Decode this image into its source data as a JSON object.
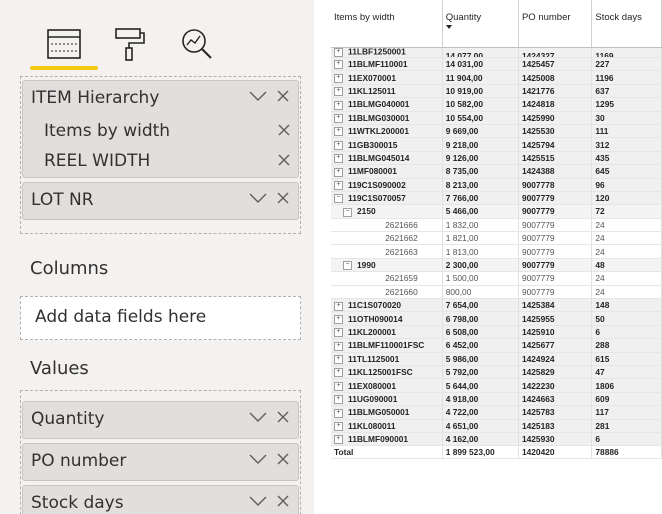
{
  "pane": {
    "icons": [
      "table-fields-icon",
      "paint-roller-format-icon",
      "analytics-magnifier-icon"
    ],
    "rows_well": {
      "hierarchy_label": "ITEM Hierarchy",
      "hierarchy_children": [
        "Items by width",
        "REEL WIDTH"
      ],
      "lot_label": "LOT NR"
    },
    "columns_label": "Columns",
    "columns_placeholder": "Add data fields here",
    "values_label": "Values",
    "values_fields": [
      "Quantity",
      "PO number",
      "Stock days"
    ]
  },
  "matrix": {
    "headers": [
      "Items by width",
      "Quantity",
      "PO number",
      "Stock days"
    ],
    "sorted_column": "Quantity",
    "cut_row": {
      "item": "11LBF1250001",
      "qty": "14 077,00",
      "po": "1424327",
      "days": "1169"
    },
    "rows": [
      {
        "level": 0,
        "item": "11BLMF110001",
        "qty": "14 031,00",
        "po": "1425457",
        "days": "227"
      },
      {
        "level": 0,
        "item": "11EX070001",
        "qty": "11 904,00",
        "po": "1425008",
        "days": "1196"
      },
      {
        "level": 0,
        "item": "11KL125011",
        "qty": "10 919,00",
        "po": "1421776",
        "days": "637"
      },
      {
        "level": 0,
        "item": "11BLMG040001",
        "qty": "10 582,00",
        "po": "1424818",
        "days": "1295"
      },
      {
        "level": 0,
        "item": "11BLMG030001",
        "qty": "10 554,00",
        "po": "1425990",
        "days": "30"
      },
      {
        "level": 0,
        "item": "11WTKL200001",
        "qty": "9 669,00",
        "po": "1425530",
        "days": "111"
      },
      {
        "level": 0,
        "item": "11GB300015",
        "qty": "9 218,00",
        "po": "1425794",
        "days": "312"
      },
      {
        "level": 0,
        "item": "11BLMG045014",
        "qty": "9 126,00",
        "po": "1425515",
        "days": "435"
      },
      {
        "level": 0,
        "item": "11MF080001",
        "qty": "8 735,00",
        "po": "1424388",
        "days": "645"
      },
      {
        "level": 0,
        "item": "119C1S090002",
        "qty": "8 213,00",
        "po": "9007778",
        "days": "96"
      },
      {
        "level": 0,
        "item": "119C1S070057",
        "qty": "7 766,00",
        "po": "9007779",
        "days": "120",
        "expanded": true
      },
      {
        "level": 1,
        "item": "2150",
        "qty": "5 466,00",
        "po": "9007779",
        "days": "72",
        "expanded": true
      },
      {
        "level": 2,
        "item": "2621666",
        "qty": "1 832,00",
        "po": "9007779",
        "days": "24"
      },
      {
        "level": 2,
        "item": "2621662",
        "qty": "1 821,00",
        "po": "9007779",
        "days": "24"
      },
      {
        "level": 2,
        "item": "2621663",
        "qty": "1 813,00",
        "po": "9007779",
        "days": "24"
      },
      {
        "level": 1,
        "item": "1990",
        "qty": "2 300,00",
        "po": "9007779",
        "days": "48",
        "expanded": true
      },
      {
        "level": 2,
        "item": "2621659",
        "qty": "1 500,00",
        "po": "9007779",
        "days": "24"
      },
      {
        "level": 2,
        "item": "2621660",
        "qty": "800,00",
        "po": "9007779",
        "days": "24"
      },
      {
        "level": 0,
        "item": "11C1S070020",
        "qty": "7 654,00",
        "po": "1425384",
        "days": "148"
      },
      {
        "level": 0,
        "item": "11OTH090014",
        "qty": "6 798,00",
        "po": "1425955",
        "days": "50"
      },
      {
        "level": 0,
        "item": "11KL200001",
        "qty": "6 508,00",
        "po": "1425910",
        "days": "6"
      },
      {
        "level": 0,
        "item": "11BLMF110001FSC",
        "qty": "6 452,00",
        "po": "1425677",
        "days": "288"
      },
      {
        "level": 0,
        "item": "11TL1125001",
        "qty": "5 986,00",
        "po": "1424924",
        "days": "615"
      },
      {
        "level": 0,
        "item": "11KL125001FSC",
        "qty": "5 792,00",
        "po": "1425829",
        "days": "47"
      },
      {
        "level": 0,
        "item": "11EX080001",
        "qty": "5 644,00",
        "po": "1422230",
        "days": "1806"
      },
      {
        "level": 0,
        "item": "11UG090001",
        "qty": "4 918,00",
        "po": "1424663",
        "days": "609"
      },
      {
        "level": 0,
        "item": "11BLMG050001",
        "qty": "4 722,00",
        "po": "1425783",
        "days": "117"
      },
      {
        "level": 0,
        "item": "11KL080011",
        "qty": "4 651,00",
        "po": "1425183",
        "days": "281"
      },
      {
        "level": 0,
        "item": "11BLMF090001",
        "qty": "4 162,00",
        "po": "1425930",
        "days": "6"
      }
    ],
    "total": {
      "item": "Total",
      "qty": "1 899 523,00",
      "po": "1420420",
      "days": "78886"
    }
  },
  "colors": {
    "pane_bg": "#f3f2f1",
    "pill_bg": "#e1dfdd",
    "accent": "#f2c811"
  }
}
